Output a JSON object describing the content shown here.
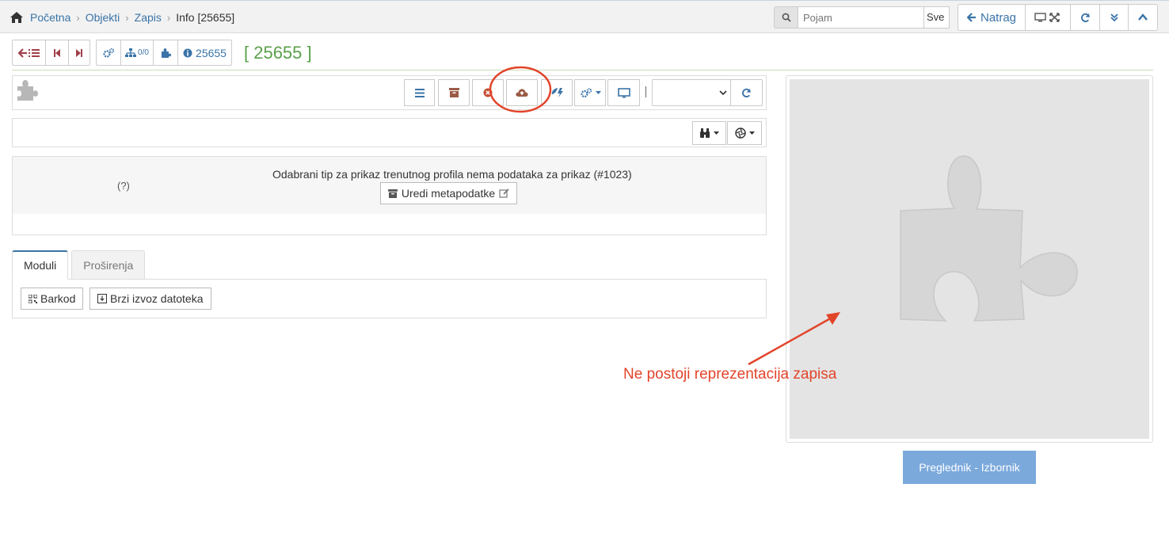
{
  "breadcrumb": {
    "home_icon": "home-icon",
    "items": [
      "Početna",
      "Objekti",
      "Zapis"
    ],
    "current": "Info [25655]"
  },
  "search": {
    "placeholder": "Pojam",
    "scope": "Sve"
  },
  "top_buttons": {
    "back_label": "Natrag"
  },
  "record": {
    "id_button": "25655",
    "title": "[ 25655 ]",
    "children_count": "0/0"
  },
  "message": {
    "help": "(?)",
    "text": "Odabrani tip za prikaz trenutnog profila nema podataka za prikaz (#1023)",
    "edit_button": "Uredi metapodatke"
  },
  "tabs": [
    {
      "label": "Moduli",
      "active": true
    },
    {
      "label": "Proširenja",
      "active": false
    }
  ],
  "modules": {
    "barcode": "Barkod",
    "export": "Brzi izvoz datoteka"
  },
  "preview": {
    "viewer_button": "Preglednik - Izbornik"
  },
  "annotation": {
    "text": "Ne postoji reprezentacija zapisa",
    "color": "#e2442a"
  },
  "colors": {
    "link": "#3a74a8",
    "accent_red": "#a0414b",
    "title_green": "#5aa04a",
    "viewer_button": "#7ba9dc",
    "action_brown": "#9a5a45"
  }
}
